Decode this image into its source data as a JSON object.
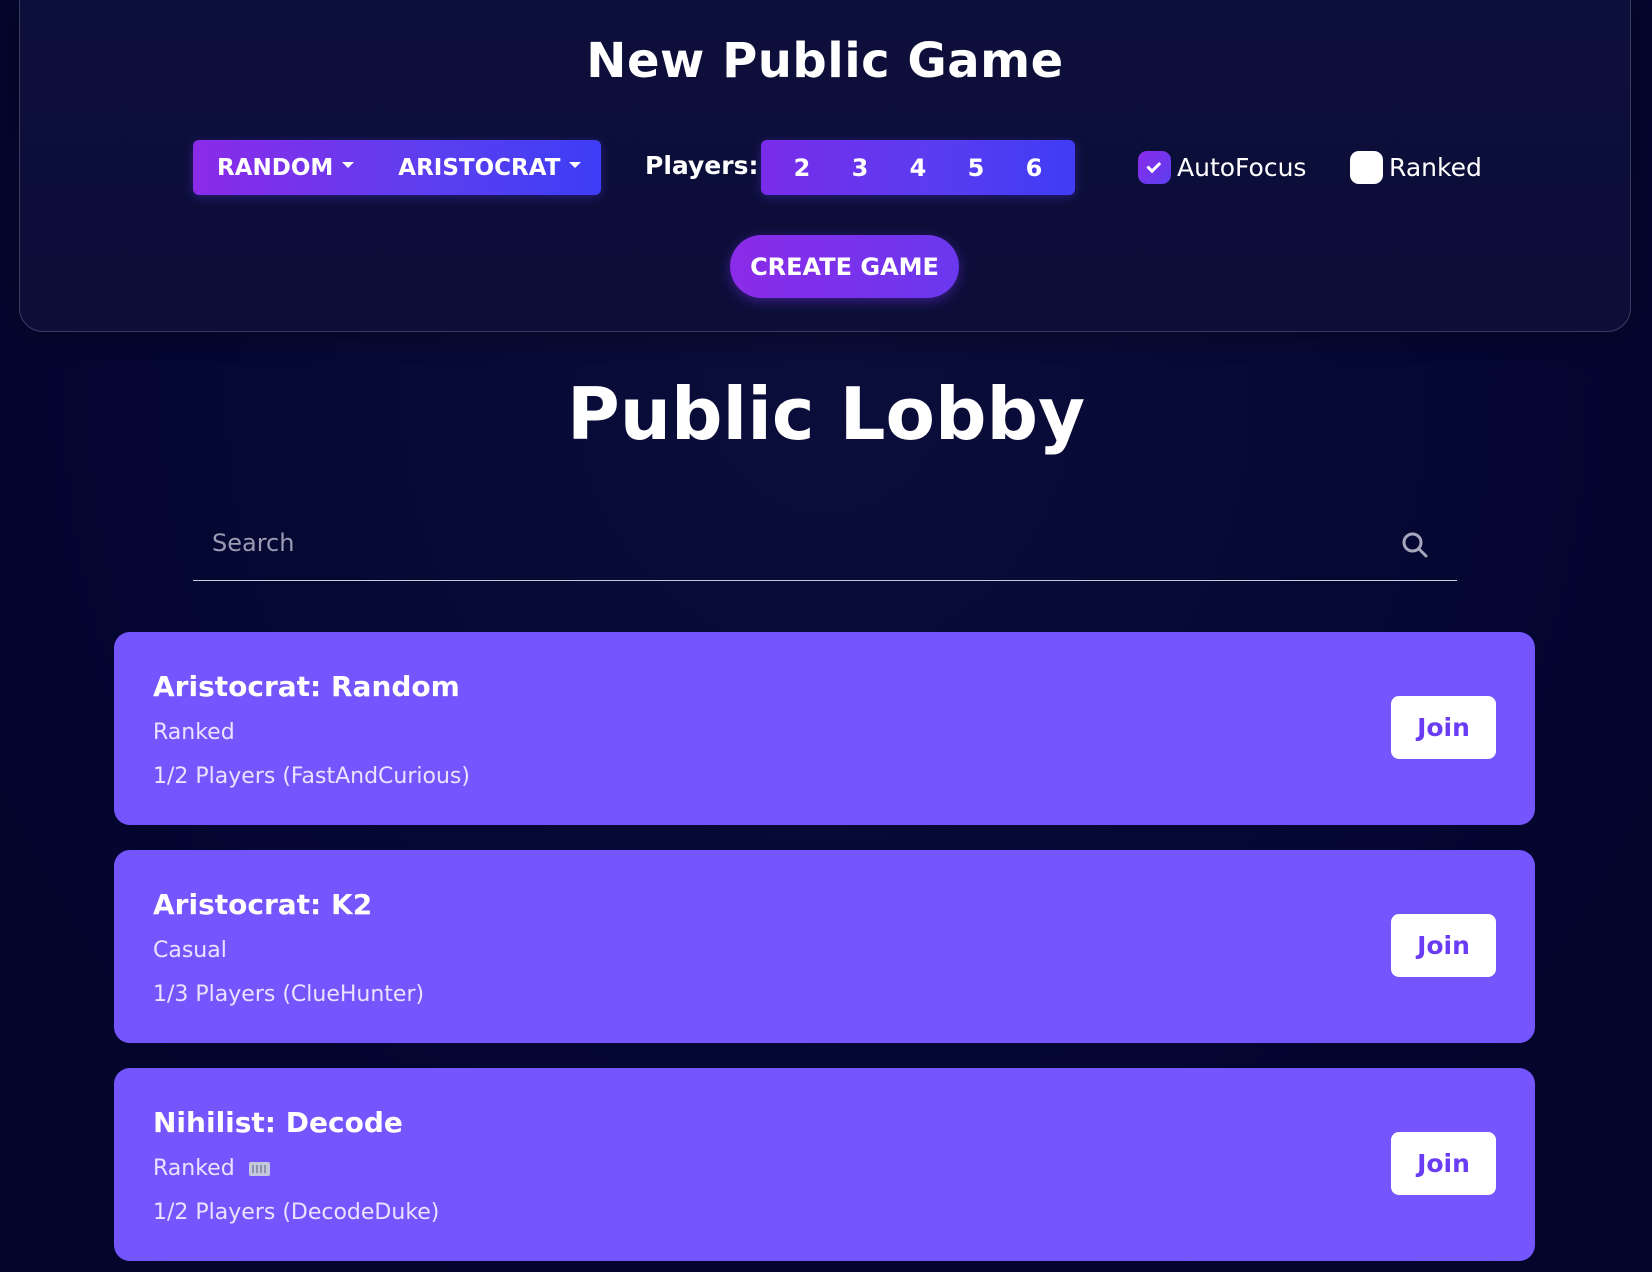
{
  "new_game": {
    "title": "New Public Game",
    "cipher_dropdown": "RANDOM",
    "type_dropdown": "ARISTOCRAT",
    "players_label": "Players:",
    "player_options": [
      "2",
      "3",
      "4",
      "5",
      "6"
    ],
    "autofocus_label": "AutoFocus",
    "autofocus_checked": true,
    "ranked_label": "Ranked",
    "ranked_checked": false,
    "create_label": "CREATE GAME"
  },
  "lobby": {
    "title": "Public Lobby",
    "search_placeholder": "Search",
    "games": [
      {
        "title": "Aristocrat: Random",
        "mode": "Ranked",
        "players": "1/2 Players (FastAndCurious)",
        "join_label": "Join",
        "keyboard_icon": false
      },
      {
        "title": "Aristocrat: K2",
        "mode": "Casual",
        "players": "1/3 Players (ClueHunter)",
        "join_label": "Join",
        "keyboard_icon": false
      },
      {
        "title": "Nihilist: Decode",
        "mode": "Ranked",
        "players": "1/2 Players (DecodeDuke)",
        "join_label": "Join",
        "keyboard_icon": true
      }
    ]
  },
  "colors": {
    "background": "#050733",
    "panel": "#0d0f3b",
    "card": "#7555fd",
    "accent_purple": "#8b2be8",
    "accent_blue": "#3d3df5",
    "join_text": "#6a3df5"
  }
}
